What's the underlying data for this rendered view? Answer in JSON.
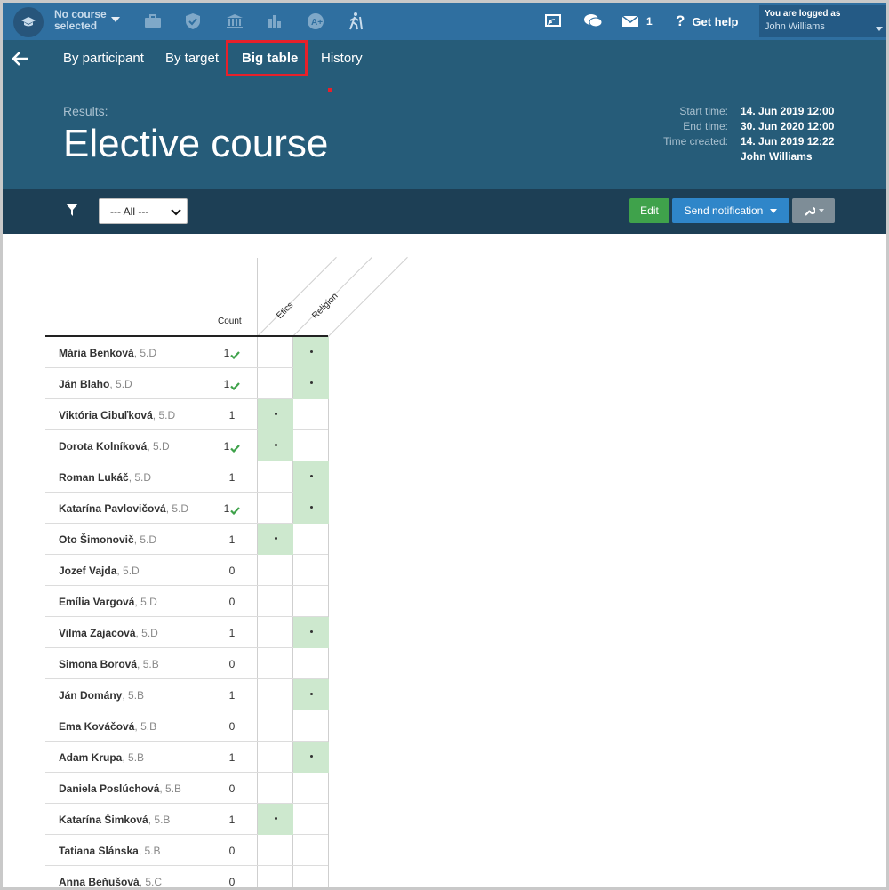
{
  "topbar": {
    "course_selector": "No course selected",
    "mail_count": "1",
    "help_label": "Get help",
    "login_caption": "You are logged as",
    "login_user": "John Williams",
    "icons": [
      "graduation-cap-icon",
      "briefcase-icon",
      "shield-check-icon",
      "institution-icon",
      "bar-chart-icon",
      "a-plus-icon",
      "hiking-icon",
      "cast-icon",
      "chat-icon",
      "mail-icon",
      "question-icon"
    ]
  },
  "nav": {
    "tabs": [
      "By participant",
      "By target",
      "Big table",
      "History"
    ],
    "active": "Big table"
  },
  "header": {
    "results_label": "Results:",
    "title": "Elective course",
    "start_label": "Start time:",
    "start_value": "14. Jun 2019 12:00",
    "end_label": "End time:",
    "end_value": "30. Jun 2020 12:00",
    "created_label": "Time created:",
    "created_value": "14. Jun 2019 12:22",
    "created_by": "John Williams"
  },
  "filter": {
    "select_value": "--- All ---",
    "edit_label": "Edit",
    "send_label": "Send notification"
  },
  "table": {
    "count_header": "Count",
    "options": [
      "Etics",
      "Religion"
    ],
    "selected_color": "#cde8ce",
    "rows": [
      {
        "name": "Mária Benková",
        "cls": "5.D",
        "count": "1",
        "check": true,
        "choice": 1
      },
      {
        "name": "Ján Blaho",
        "cls": "5.D",
        "count": "1",
        "check": true,
        "choice": 1
      },
      {
        "name": "Viktória Cibuľková",
        "cls": "5.D",
        "count": "1",
        "check": false,
        "choice": 0
      },
      {
        "name": "Dorota Kolníková",
        "cls": "5.D",
        "count": "1",
        "check": true,
        "choice": 0
      },
      {
        "name": "Roman Lukáč",
        "cls": "5.D",
        "count": "1",
        "check": false,
        "choice": 1
      },
      {
        "name": "Katarína Pavlovičová",
        "cls": "5.D",
        "count": "1",
        "check": true,
        "choice": 1
      },
      {
        "name": "Oto Šimonovič",
        "cls": "5.D",
        "count": "1",
        "check": false,
        "choice": 0
      },
      {
        "name": "Jozef Vajda",
        "cls": "5.D",
        "count": "0",
        "check": false,
        "choice": -1
      },
      {
        "name": "Emília Vargová",
        "cls": "5.D",
        "count": "0",
        "check": false,
        "choice": -1
      },
      {
        "name": "Vilma Zajacová",
        "cls": "5.D",
        "count": "1",
        "check": false,
        "choice": 1
      },
      {
        "name": "Simona Borová",
        "cls": "5.B",
        "count": "0",
        "check": false,
        "choice": -1
      },
      {
        "name": "Ján Domány",
        "cls": "5.B",
        "count": "1",
        "check": false,
        "choice": 1
      },
      {
        "name": "Ema Kováčová",
        "cls": "5.B",
        "count": "0",
        "check": false,
        "choice": -1
      },
      {
        "name": "Adam Krupa",
        "cls": "5.B",
        "count": "1",
        "check": false,
        "choice": 1
      },
      {
        "name": "Daniela Poslúchová",
        "cls": "5.B",
        "count": "0",
        "check": false,
        "choice": -1
      },
      {
        "name": "Katarína Šimková",
        "cls": "5.B",
        "count": "1",
        "check": false,
        "choice": 0
      },
      {
        "name": "Tatiana Slánska",
        "cls": "5.B",
        "count": "0",
        "check": false,
        "choice": -1
      },
      {
        "name": "Anna Beňušová",
        "cls": "5.C",
        "count": "0",
        "check": false,
        "choice": -1
      }
    ]
  }
}
